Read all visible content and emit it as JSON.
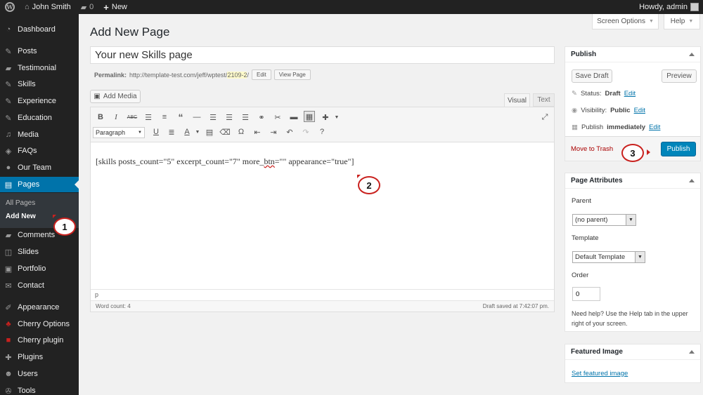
{
  "admin_bar": {
    "site_name": "John Smith",
    "comments_count": "0",
    "new_label": "New",
    "howdy": "Howdy, admin"
  },
  "sidebar": {
    "items": [
      {
        "label": "Dashboard",
        "icon": "dashboard-icon"
      },
      {
        "label": "Posts",
        "icon": "pin-icon"
      },
      {
        "label": "Testimonial",
        "icon": "speech-bubble-icon"
      },
      {
        "label": "Skills",
        "icon": "pin-icon"
      },
      {
        "label": "Experience",
        "icon": "pin-icon"
      },
      {
        "label": "Education",
        "icon": "pin-icon"
      },
      {
        "label": "Media",
        "icon": "media-icon"
      },
      {
        "label": "FAQs",
        "icon": "faq-icon"
      },
      {
        "label": "Our Team",
        "icon": "team-icon"
      },
      {
        "label": "Pages",
        "icon": "page-icon"
      },
      {
        "label": "Comments",
        "icon": "speech-bubble-icon"
      },
      {
        "label": "Slides",
        "icon": "slides-icon"
      },
      {
        "label": "Portfolio",
        "icon": "portfolio-icon"
      },
      {
        "label": "Contact",
        "icon": "mail-icon"
      },
      {
        "label": "Appearance",
        "icon": "brush-icon"
      },
      {
        "label": "Cherry Options",
        "icon": "cherry-icon"
      },
      {
        "label": "Cherry plugin",
        "icon": "cherry-plugin-icon"
      },
      {
        "label": "Plugins",
        "icon": "plugin-icon"
      },
      {
        "label": "Users",
        "icon": "user-icon"
      },
      {
        "label": "Tools",
        "icon": "wrench-icon"
      }
    ],
    "submenu": [
      "All Pages",
      "Add New"
    ]
  },
  "header": {
    "title": "Add New Page",
    "screen_options": "Screen Options",
    "help": "Help"
  },
  "editor": {
    "title_value": "Your new Skills page",
    "permalink_label": "Permalink:",
    "permalink_base": "http://template-test.com/jeff/wptest/",
    "permalink_slug": "2109-2",
    "permalink_end": "/",
    "edit_btn": "Edit",
    "view_btn": "View Page",
    "add_media": "Add Media",
    "tab_visual": "Visual",
    "tab_text": "Text",
    "format_value": "Paragraph",
    "content_pre": "[skills posts_count=\"5\" excerpt_count=\"7\" more_",
    "content_squig": "btn",
    "content_post": "=\"\" appearance=\"true\"]",
    "path": "p",
    "word_count": "Word count: 4",
    "draft_saved": "Draft saved at 7:42:07 pm."
  },
  "publish": {
    "title": "Publish",
    "save_draft": "Save Draft",
    "preview": "Preview",
    "status_label": "Status:",
    "status_value": "Draft",
    "visibility_label": "Visibility:",
    "visibility_value": "Public",
    "publish_label": "Publish",
    "publish_value": "immediately",
    "edit": "Edit",
    "trash": "Move to Trash",
    "publish_btn": "Publish"
  },
  "page_attributes": {
    "title": "Page Attributes",
    "parent_label": "Parent",
    "parent_value": "(no parent)",
    "template_label": "Template",
    "template_value": "Default Template",
    "order_label": "Order",
    "order_value": "0",
    "help_text": "Need help? Use the Help tab in the upper right of your screen."
  },
  "featured_image": {
    "title": "Featured Image",
    "link": "Set featured image"
  },
  "markers": [
    "1",
    "2",
    "3"
  ],
  "colors": {
    "admin_bar": "#222222",
    "active": "#0073aa",
    "marker_red": "#c9211e",
    "publish_btn": "#0085ba"
  }
}
